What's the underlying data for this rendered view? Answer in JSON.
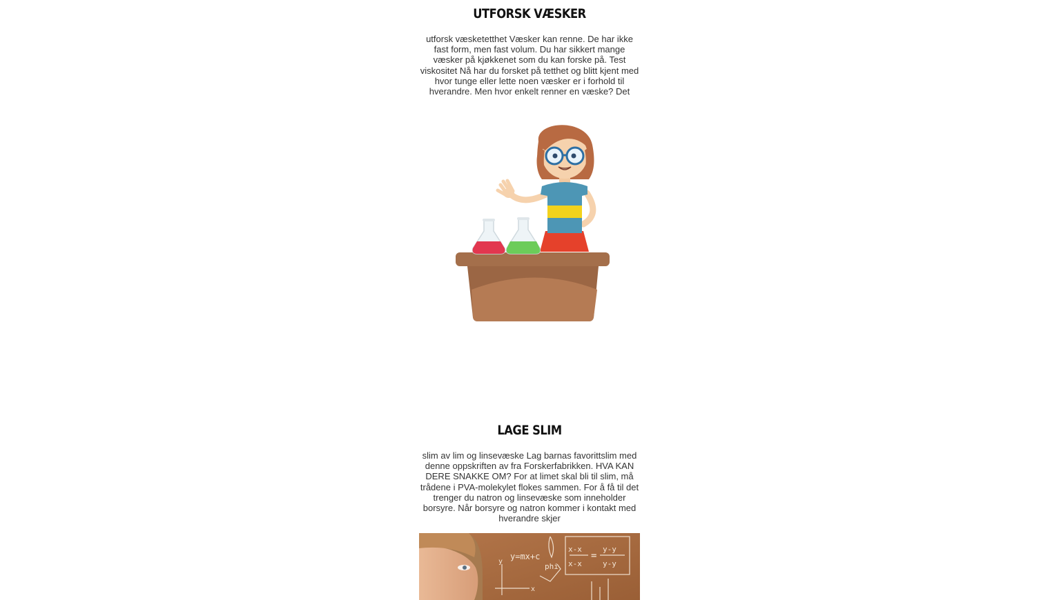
{
  "sections": [
    {
      "title": "UTFORSK VÆSKER",
      "text": "utforsk væsketetthet Væsker kan renne. De har ikke fast form, men fast volum. Du har sikkert mange væsker på kjøkkenet som du kan forske på. Test viskositet Nå har du forsket på tetthet og blitt kjent med hvor tunge eller lette noen væsker er i forhold til hverandre. Men hvor enkelt renner en væske? Det",
      "image_icon": "scientist-girl-illustration"
    },
    {
      "title": "LAGE SLIM",
      "text": "slim av lim og linsevæske Lag barnas favorittslim med denne oppskriften av fra Forskerfabrikken. HVA KAN DERE SNAKKE OM? For at limet skal bli til slim, må trådene i PVA-molekylet flokes sammen. For å få til det trenger du natron og linsevæske som inneholder borsyre. Når borsyre og natron kommer i kontakt med hverandre skjer",
      "image_icon": "chalkboard-photo",
      "chalk_formulas": {
        "line_eq": "y=mx+c",
        "phi": "phi",
        "frac_left_top": "x-x",
        "frac_left_bottom": "x-x",
        "equals": "=",
        "frac_right_top": "y-y",
        "frac_right_bottom": "y-y",
        "axis_x": "x",
        "axis_y": "y"
      }
    }
  ],
  "colors": {
    "background": "#ffffff",
    "title": "#111111",
    "text": "#333333",
    "desk": "#a46f4b",
    "chalkboard": "#a5673d"
  }
}
